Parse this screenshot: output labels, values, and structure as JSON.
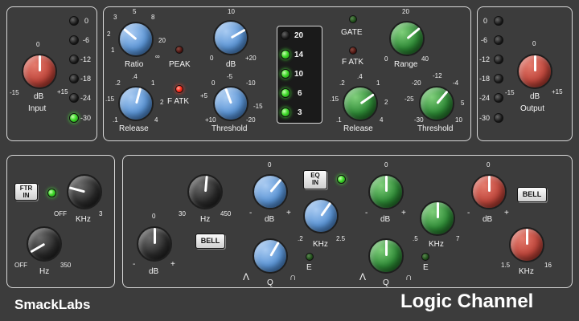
{
  "brand": {
    "company": "SmackLabs",
    "product": "Logic Channel"
  },
  "input": {
    "label": "Input",
    "unit": "dB",
    "min": "-15",
    "max": "+15",
    "mid": "0",
    "meter": [
      "0",
      "-6",
      "-12",
      "-18",
      "-24",
      "-30"
    ]
  },
  "output": {
    "label": "Output",
    "unit": "dB",
    "min": "-15",
    "max": "+15",
    "mid": "0",
    "meter": [
      "0",
      "-6",
      "-12",
      "-18",
      "-24",
      "-30"
    ]
  },
  "compressor": {
    "ratio": {
      "label": "Ratio",
      "t": [
        "1",
        "2",
        "3",
        "5",
        "8",
        "20",
        "∞"
      ]
    },
    "threshold_top": {
      "label": "dB",
      "t": [
        "0",
        "10",
        "+20"
      ]
    },
    "peak": "PEAK",
    "fatk": "F ATK",
    "release": {
      "label": "Release",
      "t": [
        ".1",
        ".15",
        ".2",
        ".4",
        "1",
        "2",
        "4"
      ]
    },
    "threshold": {
      "label": "Threshold",
      "t": [
        "+10",
        "+5",
        "0",
        "-5",
        "-10",
        "-15",
        "-20"
      ]
    }
  },
  "gr_meter": [
    "20",
    "14",
    "10",
    "6",
    "3"
  ],
  "gate": {
    "gate_label": "GATE",
    "fatk_label": "F ATK",
    "range": {
      "label": "Range",
      "t": [
        "0",
        "20",
        "40"
      ]
    },
    "release": {
      "label": "Release",
      "t": [
        ".1",
        ".15",
        ".2",
        ".4",
        "1",
        "2",
        "4"
      ]
    },
    "threshold": {
      "label": "Threshold",
      "t": [
        "-30",
        "-25",
        "-20",
        "-12",
        "-4",
        "5",
        "10"
      ]
    }
  },
  "filter": {
    "button": [
      "FTR",
      "IN"
    ],
    "lp": {
      "label": "KHz",
      "min": "OFF",
      "max": "3"
    },
    "hp": {
      "label": "Hz",
      "min": "OFF",
      "max": "350"
    }
  },
  "eq": {
    "button": [
      "EQ",
      "IN"
    ],
    "low": {
      "freq_label": "Hz",
      "freq_min": "30",
      "freq_max": "450",
      "gain_label": "dB",
      "gain_mid": "0",
      "gain_min": "-",
      "gain_max": "+",
      "bell": "BELL"
    },
    "lowmid": {
      "gain_label": "dB",
      "gain_mid": "0",
      "gain_min": "-",
      "gain_max": "+",
      "freq_label": "KHz",
      "freq_min": ".2",
      "freq_max": "2.5",
      "q_label": "Q",
      "q_min": "Λ",
      "q_max": "∩",
      "e_label": "E"
    },
    "highmid": {
      "gain_label": "dB",
      "gain_mid": "0",
      "gain_min": "-",
      "gain_max": "+",
      "freq_label": "KHz",
      "freq_min": ".5",
      "freq_max": "7",
      "q_label": "Q",
      "q_min": "Λ",
      "q_max": "∩",
      "e_label": "E"
    },
    "high": {
      "gain_label": "dB",
      "gain_mid": "0",
      "gain_min": "-",
      "gain_max": "+",
      "freq_label": "KHz",
      "freq_min": "1.5",
      "freq_max": "16",
      "bell": "BELL"
    }
  },
  "colors": {
    "red": "#c0473c",
    "blue": "#5b95d6",
    "green": "#2e8a36",
    "black": "#2c2c2c",
    "panel": "#3c3c3c"
  }
}
